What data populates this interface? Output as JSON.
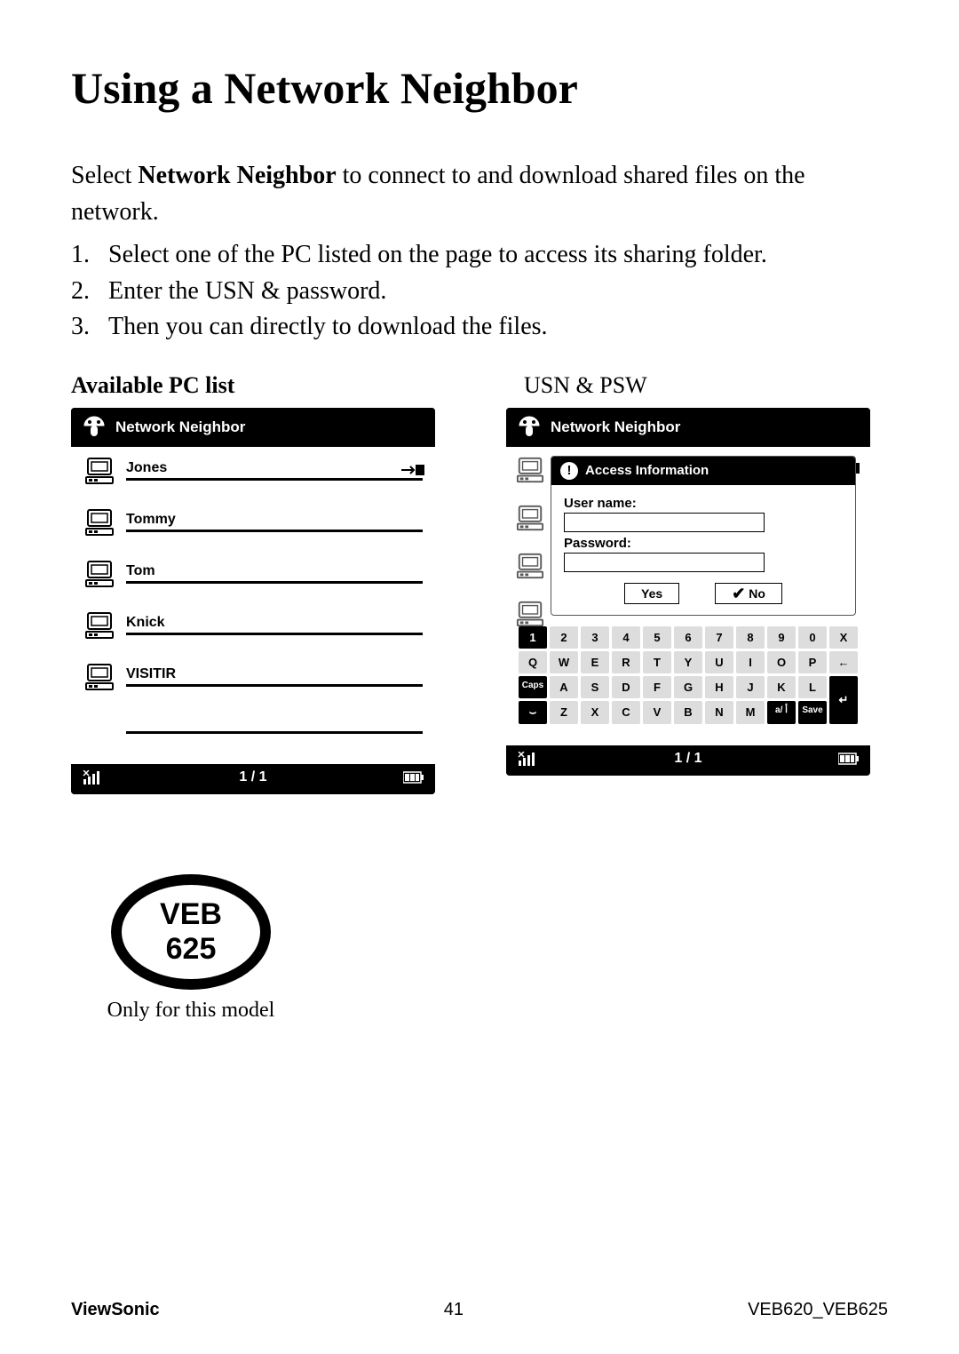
{
  "title": "Using a Network Neighbor",
  "intro_pre": "Select ",
  "intro_bold": "Network Neighbor",
  "intro_post": " to connect to and download shared files on the network.",
  "steps": [
    "Select one of the PC listed on the page to access its sharing folder.",
    "Enter the USN & password.",
    "Then you can directly to download the files."
  ],
  "caption_left": "Available PC list",
  "caption_right": "USN & PSW",
  "screen_title": "Network Neighbor",
  "pc_list": [
    "Jones",
    "Tommy",
    "Tom",
    "Knick",
    "VISITIR"
  ],
  "page_indicator": "1 / 1",
  "dialog": {
    "title": "Access Information",
    "username_label": "User name:",
    "password_label": "Password:",
    "yes": "Yes",
    "no": "No"
  },
  "keyboard": {
    "row1": [
      "1",
      "2",
      "3",
      "4",
      "5",
      "6",
      "7",
      "8",
      "9",
      "0",
      "X"
    ],
    "row2": [
      "Q",
      "W",
      "E",
      "R",
      "T",
      "Y",
      "U",
      "I",
      "O",
      "P",
      "←"
    ],
    "row3": [
      "Caps",
      "A",
      "S",
      "D",
      "F",
      "G",
      "H",
      "J",
      "K",
      "L"
    ],
    "row4": [
      "⌣",
      "Z",
      "X",
      "C",
      "V",
      "B",
      "N",
      "M",
      "a/ ﺃ",
      "Save"
    ],
    "enter": "↵"
  },
  "model": {
    "line1": "VEB",
    "line2": "625",
    "caption": "Only for this model"
  },
  "footer": {
    "left": "ViewSonic",
    "center": "41",
    "right": "VEB620_VEB625"
  }
}
